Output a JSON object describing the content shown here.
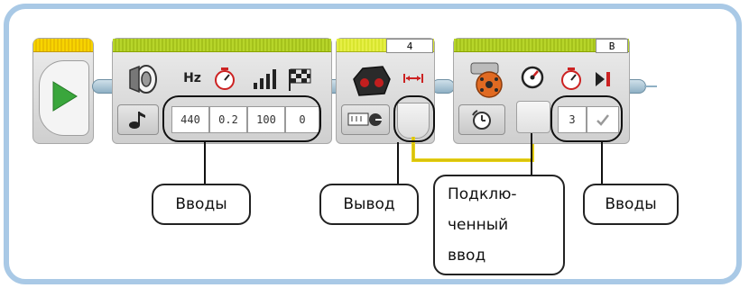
{
  "blocks": {
    "sound": {
      "labels": {
        "hz": "Hz"
      },
      "inputs": [
        "440",
        "0.2",
        "100",
        "0"
      ],
      "icons": [
        "speaker-icon",
        "note-icon",
        "timer-icon",
        "volume-bars-icon",
        "checkered-flag-icon"
      ]
    },
    "sensor": {
      "port": "4",
      "icons": [
        "ultrasonic-sensor-icon",
        "distance-arrows-icon",
        "measure-mode-icon"
      ]
    },
    "motor": {
      "port": "B",
      "inputs": [
        "3"
      ],
      "icons": [
        "medium-motor-icon",
        "speed-dial-icon",
        "timer-icon",
        "stop-icon",
        "check-icon",
        "time-mode-icon"
      ]
    }
  },
  "callouts": {
    "inputs_left": "Вводы",
    "output": "Вывод",
    "connected_input_lines": [
      "Подклю-",
      "ченный",
      "ввод"
    ],
    "inputs_right": "Вводы"
  }
}
